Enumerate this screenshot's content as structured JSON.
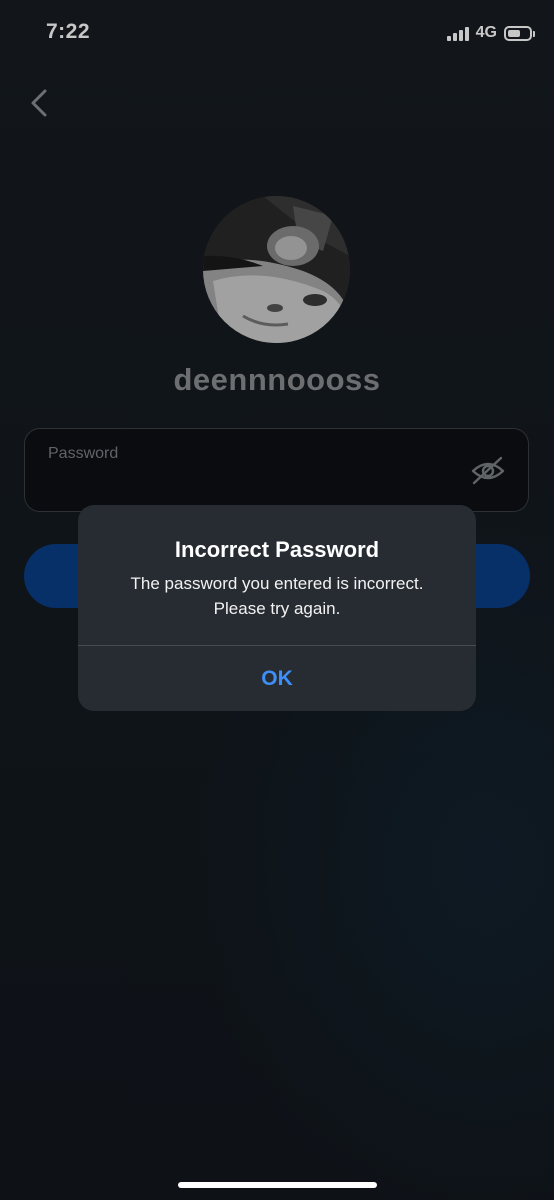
{
  "status_bar": {
    "time": "7:22",
    "network": "4G",
    "battery_level": 0.6,
    "icons": [
      "signal-icon",
      "battery-icon"
    ]
  },
  "nav": {
    "back_icon": "chevron-left-icon"
  },
  "profile": {
    "username": "deennnoooss"
  },
  "password_field": {
    "label": "Password",
    "toggle_icon": "eye-slash-icon"
  },
  "alert": {
    "title": "Incorrect Password",
    "message_line1": "The password you entered is incorrect.",
    "message_line2": "Please try again.",
    "ok_label": "OK"
  },
  "colors": {
    "accent": "#3d8ef7",
    "button": "#0a3d86",
    "dialog": "#272c33"
  }
}
